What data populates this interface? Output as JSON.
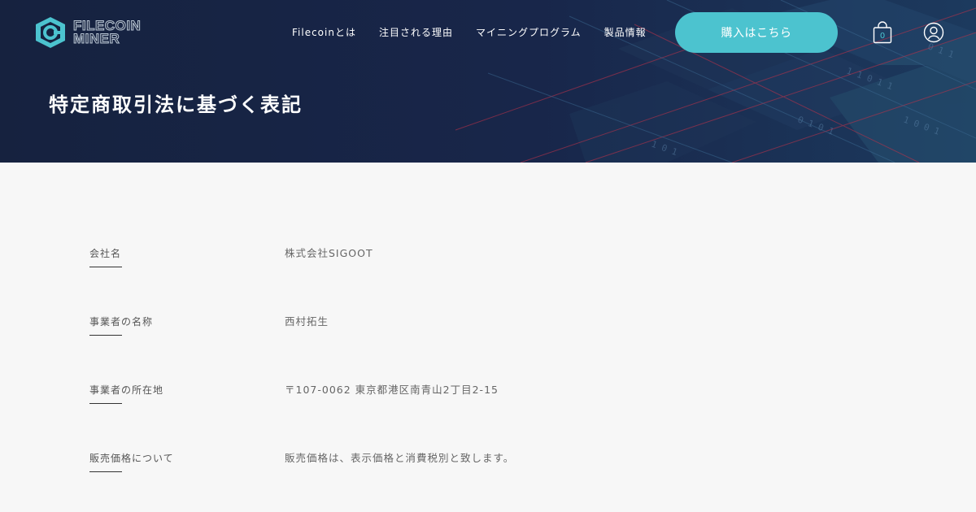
{
  "header": {
    "logo": {
      "line1": "FILECOIN",
      "line2": "MINER",
      "icon": "filecoin-logo-icon"
    },
    "nav": [
      {
        "label": "Filecoinとは"
      },
      {
        "label": "注目される理由"
      },
      {
        "label": "マイニングプログラム"
      },
      {
        "label": "製品情報"
      }
    ],
    "buy_label": "購入はこちら",
    "cart": {
      "icon": "shopping-bag-icon",
      "count": "0"
    },
    "user_icon": "user-icon"
  },
  "page": {
    "title": "特定商取引法に基づく表記"
  },
  "rows": [
    {
      "label": "会社名",
      "value": "株式会社SIGOOT"
    },
    {
      "label": "事業者の名称",
      "value": "西村拓生"
    },
    {
      "label": "事業者の所在地",
      "value": "〒107-0062 東京都港区南青山2丁目2-15"
    },
    {
      "label": "販売価格について",
      "value": "販売価格は、表示価格と消費税別と致します。"
    }
  ],
  "colors": {
    "hero_bg": "#16223f",
    "accent": "#4cc3cf",
    "content_bg": "#f7f7f7"
  }
}
